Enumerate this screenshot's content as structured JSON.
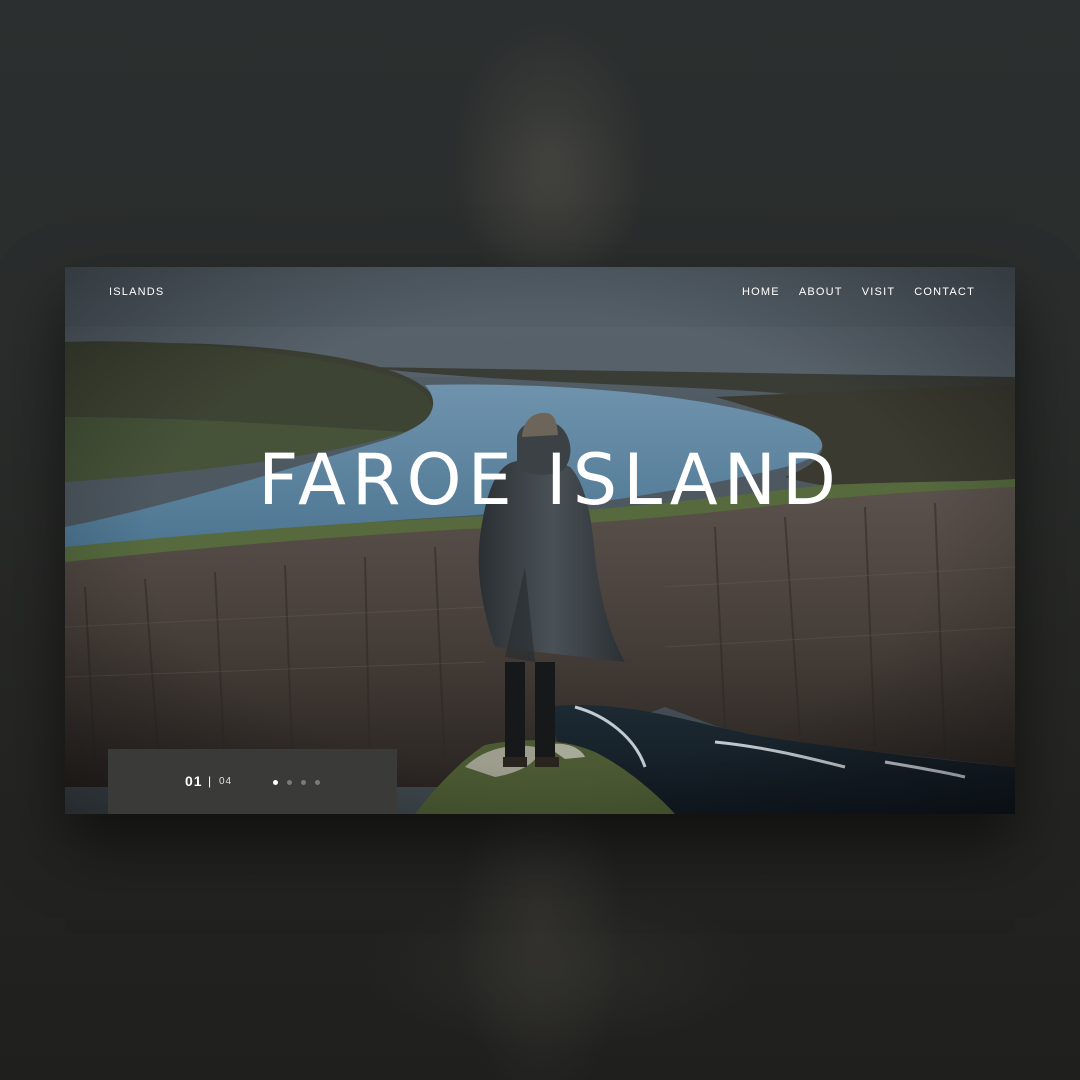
{
  "header": {
    "brand": "ISLANDS",
    "nav": [
      {
        "label": "HOME"
      },
      {
        "label": "ABOUT"
      },
      {
        "label": "VISIT"
      },
      {
        "label": "CONTACT"
      }
    ]
  },
  "hero": {
    "title": "FAROE ISLAND"
  },
  "pager": {
    "current": "01",
    "separator": "|",
    "total": "04",
    "slides": 4,
    "active_index": 0
  },
  "colors": {
    "page_background": "#2c2e2d",
    "text": "#ffffff",
    "pager_background": "#3a3a38",
    "dot_inactive": "#7a7a78",
    "dot_active": "#ffffff"
  }
}
